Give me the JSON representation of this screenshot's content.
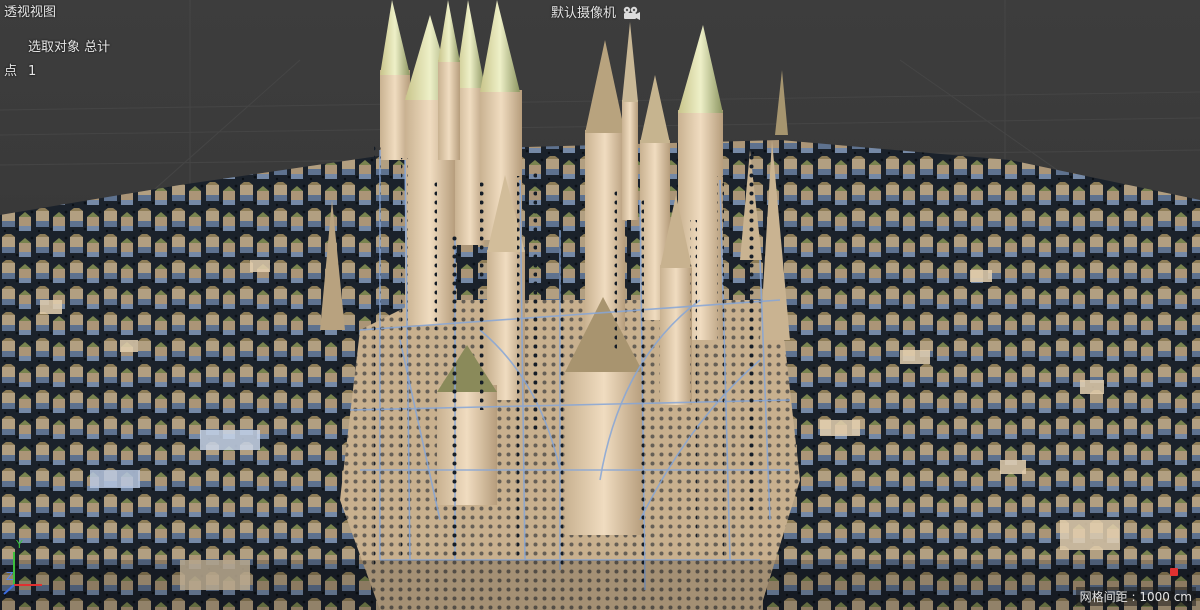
{
  "viewport": {
    "view_name": "透视视图",
    "camera_name": "默认摄像机",
    "camera_icon": "camera-icon"
  },
  "stats": {
    "header": "选取对象  总计",
    "rows": [
      {
        "label": "点",
        "value": "1"
      }
    ]
  },
  "grid": {
    "spacing_label": "网格间距 : 1000 cm"
  },
  "axes": {
    "y_label": "Y",
    "z_label": "Z"
  },
  "colors": {
    "background": "#3b3b3b",
    "building_tan": "#d9c3a3",
    "roof_olive": "#9aa568",
    "edge_blue": "#7f9fd0",
    "point_dark": "#1a2430",
    "axis_red": "#e03030",
    "axis_green": "#3cc03c",
    "axis_blue": "#3c6ce0"
  }
}
